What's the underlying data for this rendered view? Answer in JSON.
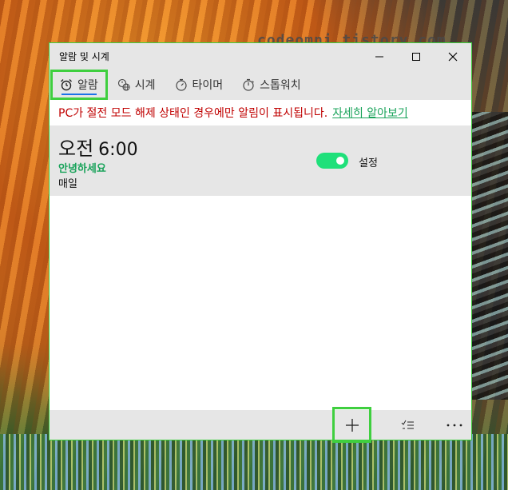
{
  "watermark": "codeomni.tistory.com",
  "window": {
    "title": "알람 및 시계",
    "controls": [
      "minimize",
      "maximize",
      "close"
    ]
  },
  "tabs": [
    {
      "label": "알람",
      "icon": "alarm-clock-icon",
      "active": true
    },
    {
      "label": "시계",
      "icon": "world-clock-icon",
      "active": false
    },
    {
      "label": "타이머",
      "icon": "timer-icon",
      "active": false
    },
    {
      "label": "스톱워치",
      "icon": "stopwatch-icon",
      "active": false
    }
  ],
  "notice": {
    "message": "PC가 절전 모드 해제 상태인 경우에만 알림이 표시됩니다.",
    "link": "자세히 알아보기"
  },
  "alarm": {
    "period": "오전",
    "time": "6:00",
    "name": "안녕하세요",
    "repeat": "매일",
    "toggle_label": "설정",
    "enabled": true
  },
  "commands": [
    {
      "name": "add-alarm",
      "icon": "plus-icon"
    },
    {
      "name": "select",
      "icon": "select-list-icon"
    },
    {
      "name": "more",
      "icon": "more-icon"
    }
  ],
  "colors": {
    "accent": "#1fe07a",
    "warning": "#c00000",
    "link": "#19a35a",
    "highlight": "#3fcf3f"
  }
}
